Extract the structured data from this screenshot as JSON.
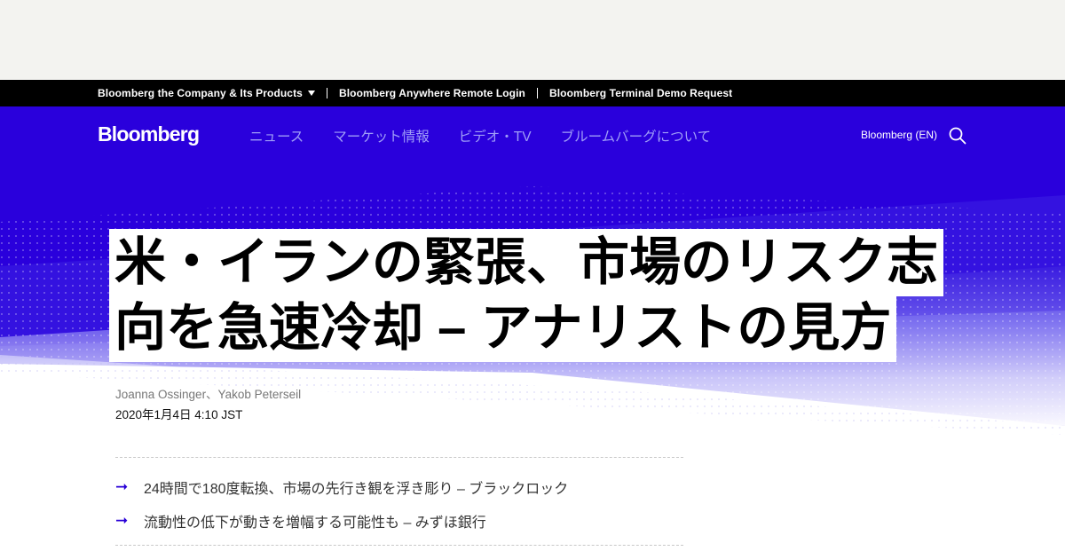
{
  "topbar": {
    "company_products": "Bloomberg the Company & Its Products",
    "anywhere_login": "Bloomberg Anywhere Remote Login",
    "terminal_demo": "Bloomberg Terminal Demo Request"
  },
  "nav": {
    "logo": "Bloomberg",
    "items": [
      "ニュース",
      "マーケット情報",
      "ビデオ・TV",
      "ブルームバーグについて"
    ],
    "edition": "Bloomberg (EN)"
  },
  "article": {
    "headline_line1": "米・イランの緊張、市場のリスク志",
    "headline_line2": "向を急速冷却 – アナリストの見方",
    "authors": "Joanna Ossinger、Yakob Peterseil",
    "date": "2020年1月4日 4:10 JST",
    "summary": [
      "24時間で180度転換、市場の先行き観を浮き彫り – ブラックロック",
      "流動性の低下が動きを増幅する可能性も – みずほ銀行"
    ]
  },
  "icons": {
    "search": "search-icon",
    "caret": "caret-down-icon",
    "arrow": "arrow-right-icon"
  },
  "colors": {
    "brand_blue": "#2800d7",
    "topbar": "#000000",
    "nav_link": "#9f9df8"
  }
}
